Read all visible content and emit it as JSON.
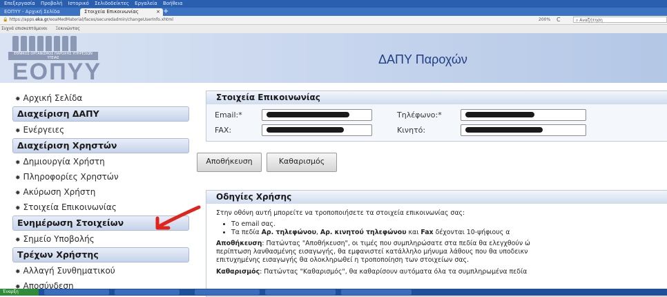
{
  "browser": {
    "menu": [
      "Επεξεργασία",
      "Προβολή",
      "Ιστορικό",
      "Σελιδοδείκτες",
      "Εργαλεία",
      "Βοήθεια"
    ],
    "tabs": [
      {
        "label": "ΕΟΠΥΥ - Αρχική Σελίδα"
      },
      {
        "label": "Στοιχεία Επικοινωνίας",
        "close": "×"
      }
    ],
    "new_tab": "+",
    "url_prefix": "https://apps.",
    "url_domain": "eka.gr",
    "url_rest": "/eoaMedMaterial/faces/securedadmin/changeUserInfo.xhtml",
    "zoom": "200%",
    "reload": "C",
    "search_placeholder": "Αναζήτηση",
    "bookmarks": [
      "Συχνά επισκεπτόμενοι",
      "Ξεκινώντας"
    ]
  },
  "header": {
    "logo_subtitle": "ΕΘΝΙΚΟΣ ΟΡΓΑΝΙΣΜΟΣ ΠΑΡΟΧΗΣ ΥΠΗΡΕΣΙΩΝ ΥΓΕΙΑΣ",
    "logo_text": "ΕΟΠΥΥ",
    "title": "ΔΑΠΥ Παροχών"
  },
  "sidebar": {
    "items": [
      {
        "type": "link",
        "label": "Αρχική Σελίδα"
      },
      {
        "type": "head",
        "label": "Διαχείριση ΔΑΠΥ"
      },
      {
        "type": "link",
        "label": "Ενέργειες"
      },
      {
        "type": "head",
        "label": "Διαχείριση Χρηστών"
      },
      {
        "type": "link",
        "label": "Δημιουργία Χρήστη"
      },
      {
        "type": "link",
        "label": "Πληροφορίες Χρηστών"
      },
      {
        "type": "link",
        "label": "Ακύρωση Χρήστη"
      },
      {
        "type": "link",
        "label": "Στοιχεία Επικοινωνίας"
      },
      {
        "type": "head",
        "label": "Ενημέρωση Στοιχείων"
      },
      {
        "type": "link",
        "label": "Σημείο Υποβολής"
      },
      {
        "type": "head",
        "label": "Τρέχων Χρήστης"
      },
      {
        "type": "link",
        "label": "Αλλαγή Συνθηματικού"
      },
      {
        "type": "link",
        "label": "Αποσύνδεση"
      }
    ],
    "arrow_color": "#e0231b"
  },
  "contact": {
    "title": "Στοιχεία Επικοινωνίας",
    "email_label": "Email:*",
    "phone_label": "Τηλέφωνο:*",
    "fax_label": "FAX:",
    "mobile_label": "Κινητό:"
  },
  "buttons": {
    "save": "Αποθήκευση",
    "clear": "Καθαρισμός"
  },
  "help": {
    "title": "Οδηγίες Χρήσης",
    "intro": "Στην οθόνη αυτή μπορείτε να τροποποιήσετε τα στοιχεία επικοινωνίας σας:",
    "bullet1": "Το email σας.",
    "bullet2_pre": "Τα πεδία ",
    "bullet2_b1": "Αρ. τηλεφώνου",
    "bullet2_c1": ", ",
    "bullet2_b2": "Αρ. κινητού τηλεφώνου",
    "bullet2_mid": " και ",
    "bullet2_b3": "Fax",
    "bullet2_post": " δέχονται 10-ψήφιους α",
    "save_label": "Αποθήκευση",
    "save_text1": ": Πατώντας \"Αποθήκευση\", οι τιμές που συμπληρώσατε στα πεδία θα ελεγχθούν ώ",
    "save_text2": "περίπτωση λανθασμένης εισαγωγής, θα εμφανιστεί κατάλληλο μήνυμα λάθους που θα υποδεικν",
    "save_text3": "επιτυχημένης εισαγωγής θα ολοκληρωθεί η τροποποίηση των στοιχείων σας.",
    "clear_label": "Καθαρισμός",
    "clear_text": ": Πατώντας \"Καθαρισμός\", θα καθαρίσουν αυτόματα όλα τα συμπληρωμένα πεδία"
  },
  "taskbar": {
    "start": "Έναρξη"
  }
}
